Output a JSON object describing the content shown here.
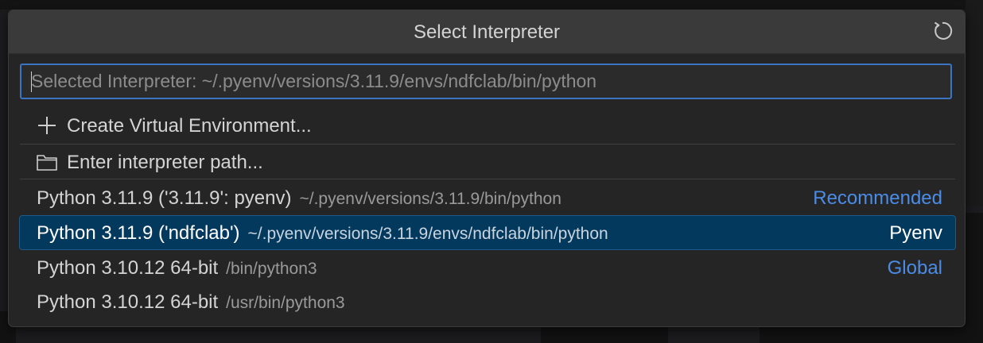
{
  "quick_pick": {
    "title": "Select Interpreter",
    "refresh_icon": "refresh-icon",
    "input": {
      "placeholder": "Selected Interpreter: ~/.pyenv/versions/3.11.9/envs/ndfclab/bin/python",
      "value": ""
    },
    "actions": [
      {
        "icon": "plus-icon",
        "label": "Create Virtual Environment..."
      },
      {
        "icon": "folder-icon",
        "label": "Enter interpreter path..."
      }
    ],
    "interpreters": [
      {
        "name": "Python 3.11.9 ('3.11.9': pyenv)",
        "path": "~/.pyenv/versions/3.11.9/bin/python",
        "tag": "Recommended",
        "selected": false
      },
      {
        "name": "Python 3.11.9 ('ndfclab')",
        "path": "~/.pyenv/versions/3.11.9/envs/ndfclab/bin/python",
        "tag": "Pyenv",
        "selected": true
      },
      {
        "name": "Python 3.10.12 64-bit",
        "path": "/bin/python3",
        "tag": "Global",
        "selected": false
      },
      {
        "name": "Python 3.10.12 64-bit",
        "path": "/usr/bin/python3",
        "tag": "",
        "selected": false
      }
    ]
  },
  "colors": {
    "accent": "#3b74c0",
    "tag_link": "#4a8ce6",
    "selected_row": "#04395e",
    "panel": "#252526",
    "header": "#3a3a3b"
  }
}
